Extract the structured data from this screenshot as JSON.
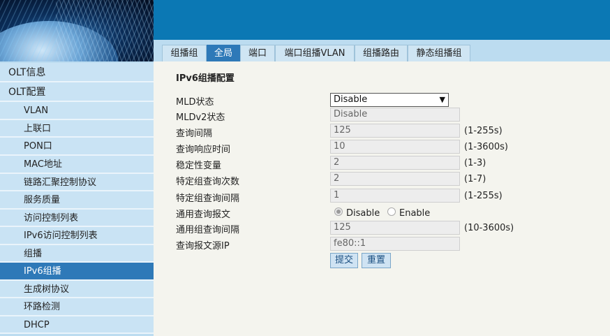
{
  "tabs": [
    "组播组",
    "全局",
    "端口",
    "端口组播VLAN",
    "组播路由",
    "静态组播组"
  ],
  "active_tab": "全局",
  "sidebar": {
    "items": [
      {
        "label": "OLT信息",
        "level": "top"
      },
      {
        "label": "OLT配置",
        "level": "top"
      },
      {
        "label": "VLAN",
        "level": "sub"
      },
      {
        "label": "上联口",
        "level": "sub"
      },
      {
        "label": "PON口",
        "level": "sub"
      },
      {
        "label": "MAC地址",
        "level": "sub"
      },
      {
        "label": "链路汇聚控制协议",
        "level": "sub"
      },
      {
        "label": "服务质量",
        "level": "sub"
      },
      {
        "label": "访问控制列表",
        "level": "sub"
      },
      {
        "label": "IPv6访问控制列表",
        "level": "sub"
      },
      {
        "label": "组播",
        "level": "sub"
      },
      {
        "label": "IPv6组播",
        "level": "sub",
        "active": true
      },
      {
        "label": "生成树协议",
        "level": "sub"
      },
      {
        "label": "环路检测",
        "level": "sub"
      },
      {
        "label": "DHCP",
        "level": "sub"
      }
    ]
  },
  "form": {
    "title": "IPv6组播配置",
    "mld_status": {
      "label": "MLD状态",
      "value": "Disable"
    },
    "mldv2_status": {
      "label": "MLDv2状态",
      "value": "Disable"
    },
    "query_interval": {
      "label": "查询间隔",
      "value": "125",
      "range": "(1-255s)"
    },
    "query_response_time": {
      "label": "查询响应时间",
      "value": "10",
      "range": "(1-3600s)"
    },
    "robustness": {
      "label": "稳定性变量",
      "value": "2",
      "range": "(1-3)"
    },
    "specific_query_count": {
      "label": "特定组查询次数",
      "value": "2",
      "range": "(1-7)"
    },
    "specific_query_interval": {
      "label": "特定组查询间隔",
      "value": "1",
      "range": "(1-255s)"
    },
    "general_query": {
      "label": "通用查询报文",
      "option_disable": "Disable",
      "option_enable": "Enable",
      "selected": "Disable"
    },
    "general_query_interval": {
      "label": "通用组查询间隔",
      "value": "125",
      "range": "(10-3600s)"
    },
    "query_source_ip": {
      "label": "查询报文源IP",
      "value": "fe80::1"
    },
    "submit_label": "提交",
    "reset_label": "重置"
  },
  "colors": {
    "header_blue": "#0b78b4",
    "active_blue": "#2e79b8",
    "sidebar_bg": "#c9e3f4",
    "content_bg": "#f4f4ee"
  }
}
